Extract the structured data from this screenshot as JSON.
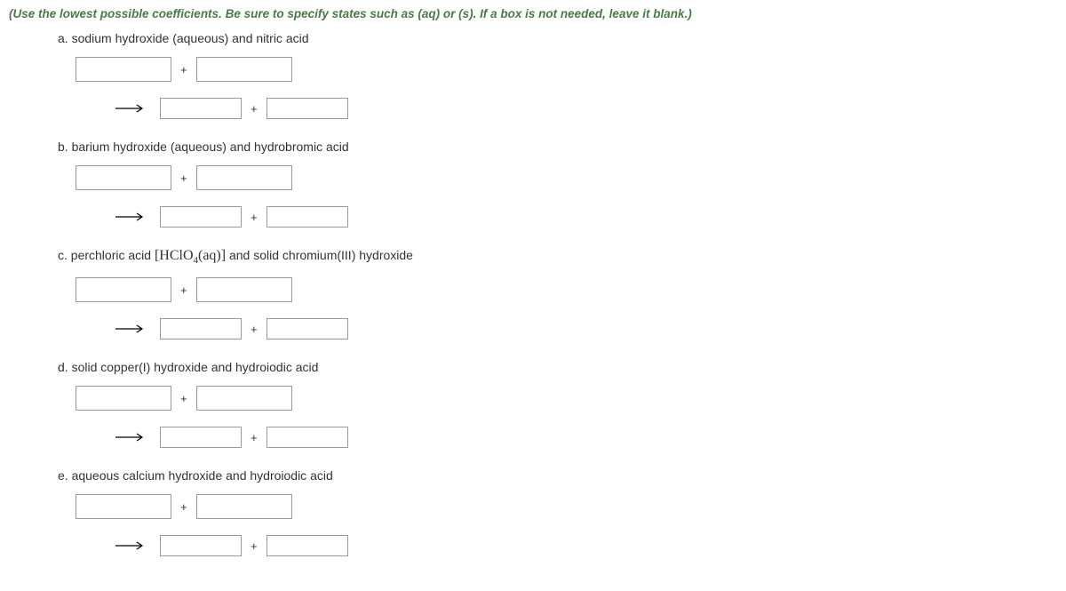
{
  "instructions": "(Use the lowest possible coefficients. Be sure to specify states such as (aq) or (s). If a box is not needed, leave it blank.)",
  "problems": {
    "a": {
      "label": "a.",
      "prompt": "sodium hydroxide (aqueous) and nitric acid",
      "reactant1": "",
      "reactant2": "",
      "product1": "",
      "product2": ""
    },
    "b": {
      "label": "b.",
      "prompt": "barium hydroxide (aqueous) and hydrobromic acid",
      "reactant1": "",
      "reactant2": "",
      "product1": "",
      "product2": ""
    },
    "c": {
      "label": "c.",
      "prompt_before": "perchloric acid ",
      "formula_prefix": "[",
      "formula_main": "HClO",
      "formula_sub": "4",
      "formula_state": "(aq)",
      "formula_suffix": "]",
      "prompt_after": " and solid chromium(III) hydroxide",
      "reactant1": "",
      "reactant2": "",
      "product1": "",
      "product2": ""
    },
    "d": {
      "label": "d.",
      "prompt": "solid copper(I) hydroxide and hydroiodic acid",
      "reactant1": "",
      "reactant2": "",
      "product1": "",
      "product2": ""
    },
    "e": {
      "label": "e.",
      "prompt": "aqueous calcium hydroxide and hydroiodic acid",
      "reactant1": "",
      "reactant2": "",
      "product1": "",
      "product2": ""
    }
  },
  "symbols": {
    "plus": "+"
  }
}
